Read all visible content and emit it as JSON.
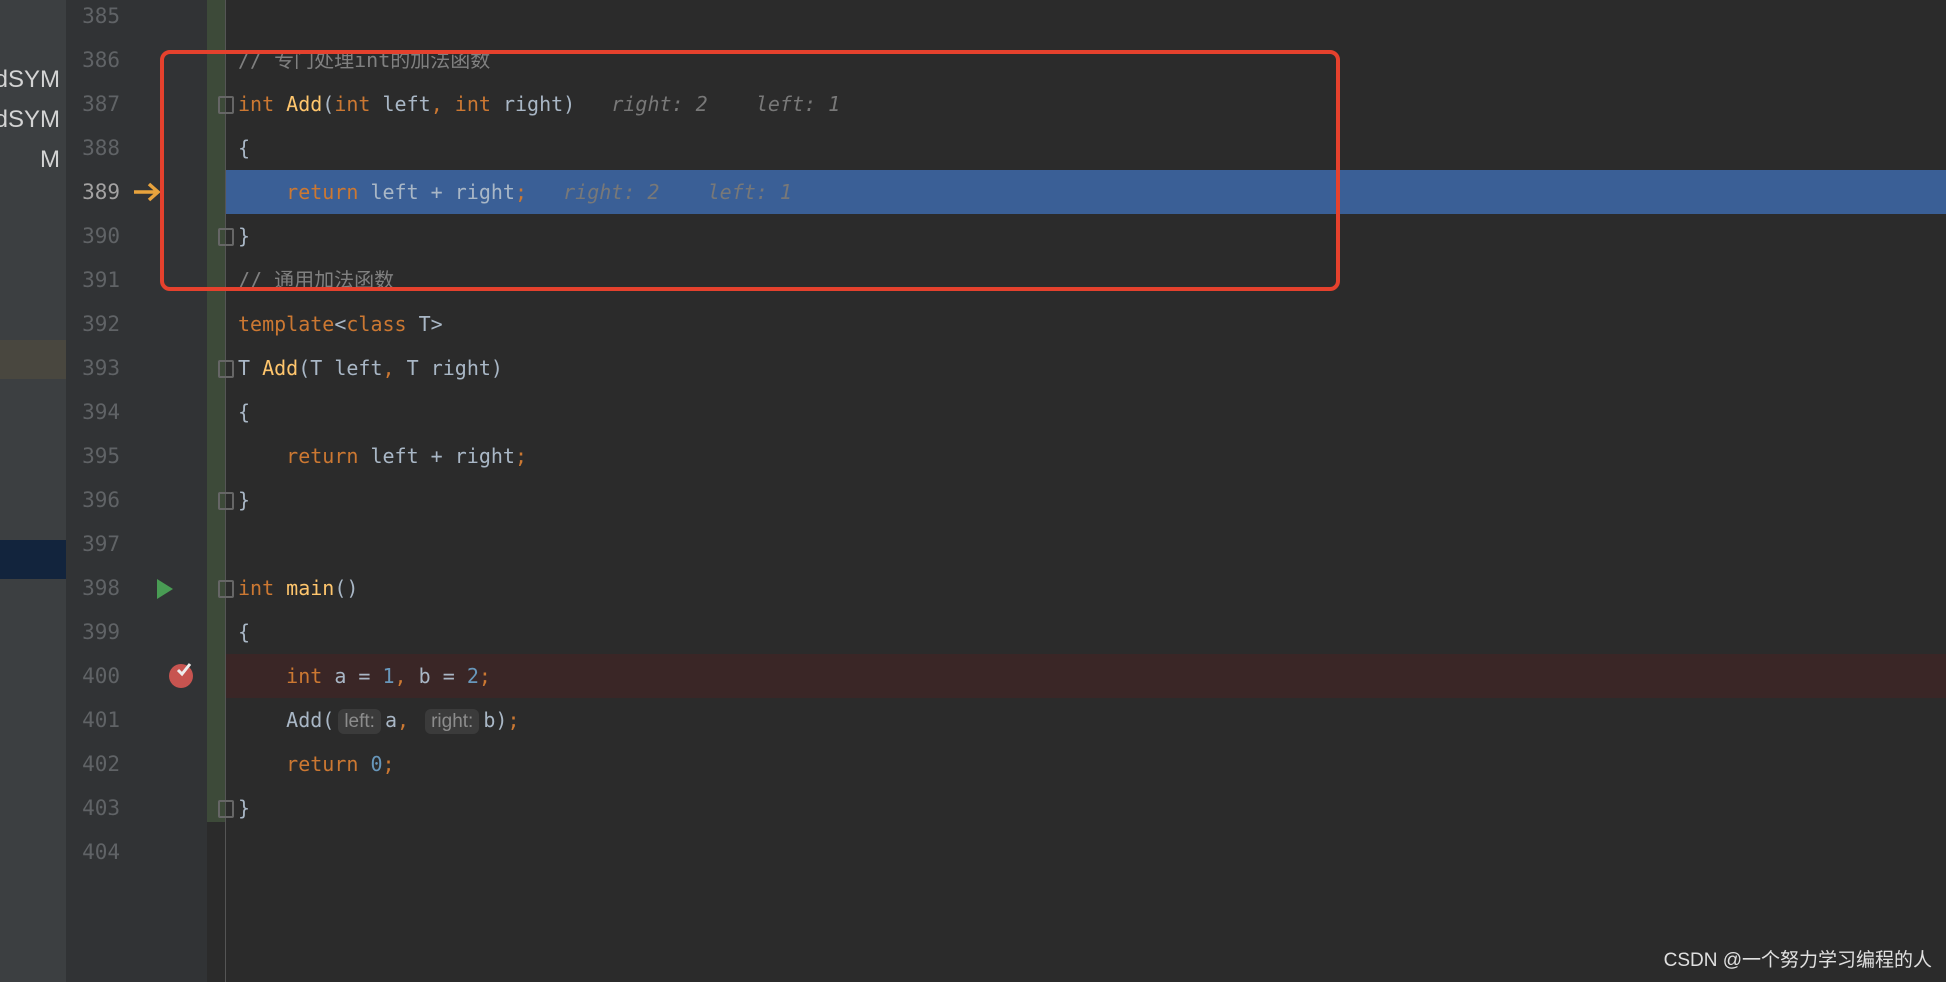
{
  "sidebar": {
    "items": [
      "dSYM",
      "dSYM",
      "M"
    ]
  },
  "colors": {
    "background": "#2b2b2b",
    "execution_line": "#3a5f96",
    "breakpoint_line": "#3a2626",
    "highlight_box": "#e5412d"
  },
  "editor": {
    "current_line": 389,
    "breakpoint_line": 400,
    "run_line": 398,
    "lines": [
      {
        "num": "385",
        "tokens": []
      },
      {
        "num": "386",
        "tokens": [
          [
            "// 专门处理int的加法函数",
            "c"
          ]
        ]
      },
      {
        "num": "387",
        "tokens": [
          [
            "int ",
            "k"
          ],
          [
            "Add",
            "f"
          ],
          [
            "(",
            "p"
          ],
          [
            "int ",
            "k"
          ],
          [
            "left",
            "p"
          ],
          [
            ", ",
            "k"
          ],
          [
            "int ",
            "k"
          ],
          [
            "right)",
            "p"
          ],
          [
            "   right: 2    left: 1",
            "hint"
          ]
        ]
      },
      {
        "num": "388",
        "tokens": [
          [
            "{",
            "p"
          ]
        ]
      },
      {
        "num": "389",
        "tokens": [
          [
            "    return ",
            "k"
          ],
          [
            "left + right",
            "p"
          ],
          [
            ";",
            "k"
          ],
          [
            "   right: 2    left: 1",
            "hint"
          ]
        ]
      },
      {
        "num": "390",
        "tokens": [
          [
            "}",
            "p"
          ]
        ]
      },
      {
        "num": "391",
        "tokens": [
          [
            "// 通用加法函数",
            "c"
          ]
        ]
      },
      {
        "num": "392",
        "tokens": [
          [
            "template",
            "k"
          ],
          [
            "<",
            "p"
          ],
          [
            "class ",
            "k"
          ],
          [
            "T>",
            "p"
          ]
        ]
      },
      {
        "num": "393",
        "tokens": [
          [
            "T ",
            "p"
          ],
          [
            "Add",
            "f"
          ],
          [
            "(T left",
            "p"
          ],
          [
            ", ",
            "k"
          ],
          [
            "T right)",
            "p"
          ]
        ]
      },
      {
        "num": "394",
        "tokens": [
          [
            "{",
            "p"
          ]
        ]
      },
      {
        "num": "395",
        "tokens": [
          [
            "    return ",
            "k"
          ],
          [
            "left + right",
            "p"
          ],
          [
            ";",
            "k"
          ]
        ]
      },
      {
        "num": "396",
        "tokens": [
          [
            "}",
            "p"
          ]
        ]
      },
      {
        "num": "397",
        "tokens": []
      },
      {
        "num": "398",
        "tokens": [
          [
            "int ",
            "k"
          ],
          [
            "main",
            "f"
          ],
          [
            "()",
            "p"
          ]
        ]
      },
      {
        "num": "399",
        "tokens": [
          [
            "{",
            "p"
          ]
        ]
      },
      {
        "num": "400",
        "tokens": [
          [
            "    int ",
            "k"
          ],
          [
            "a = ",
            "p"
          ],
          [
            "1",
            "n"
          ],
          [
            ", ",
            "k"
          ],
          [
            "b = ",
            "p"
          ],
          [
            "2",
            "n"
          ],
          [
            ";",
            "k"
          ]
        ]
      },
      {
        "num": "401",
        "tokens": [
          [
            "    Add(",
            "p"
          ],
          [
            "left:",
            "pill"
          ],
          [
            "a",
            "p"
          ],
          [
            ", ",
            "k"
          ],
          [
            "right:",
            "pill"
          ],
          [
            "b)",
            "p"
          ],
          [
            ";",
            "k"
          ]
        ]
      },
      {
        "num": "402",
        "tokens": [
          [
            "    return ",
            "k"
          ],
          [
            "0",
            "n"
          ],
          [
            ";",
            "k"
          ]
        ]
      },
      {
        "num": "403",
        "tokens": [
          [
            "}",
            "p"
          ]
        ]
      },
      {
        "num": "404",
        "tokens": []
      }
    ]
  },
  "watermark": "CSDN @一个努力学习编程的人"
}
